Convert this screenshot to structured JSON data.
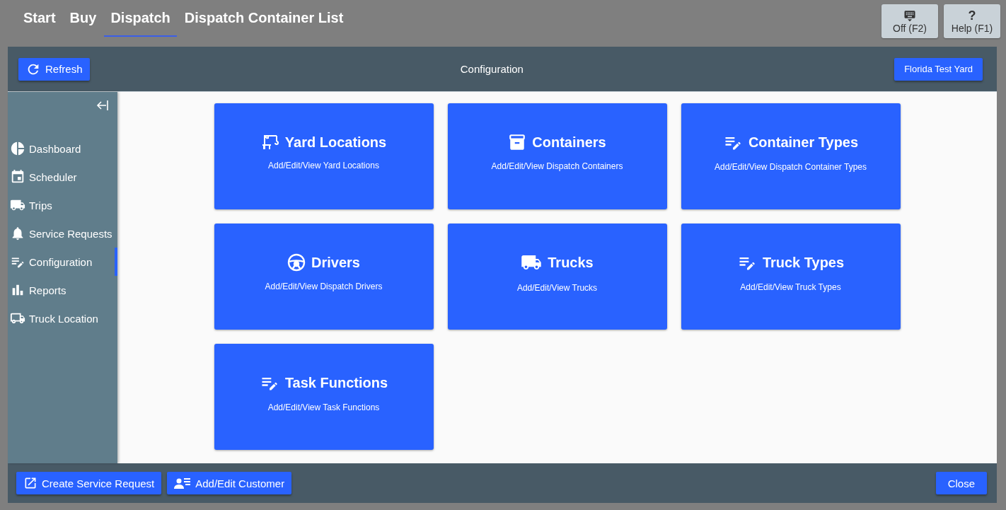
{
  "nav_tabs": [
    {
      "label": "Start",
      "selected": false
    },
    {
      "label": "Buy",
      "selected": false
    },
    {
      "label": "Dispatch",
      "selected": true
    },
    {
      "label": "Dispatch Container List",
      "selected": false
    }
  ],
  "top_buttons": [
    {
      "label": "Off (F2)"
    },
    {
      "label": "Help (F1)",
      "symbol": "?"
    }
  ],
  "header": {
    "refresh": "Refresh",
    "title": "Configuration",
    "yard": "Florida Test Yard"
  },
  "sidebar": {
    "items": [
      {
        "label": "Dashboard",
        "selected": false
      },
      {
        "label": "Scheduler",
        "selected": false
      },
      {
        "label": "Trips",
        "selected": false
      },
      {
        "label": "Service Requests",
        "selected": false
      },
      {
        "label": "Configuration",
        "selected": true
      },
      {
        "label": "Reports",
        "selected": false
      },
      {
        "label": "Truck Location",
        "selected": false
      }
    ]
  },
  "cards": [
    {
      "title": "Yard Locations",
      "subtitle": "Add/Edit/View Yard Locations"
    },
    {
      "title": "Containers",
      "subtitle": "Add/Edit/View Dispatch Containers"
    },
    {
      "title": "Container Types",
      "subtitle": "Add/Edit/View Dispatch Container Types"
    },
    {
      "title": "Drivers",
      "subtitle": "Add/Edit/View Dispatch Drivers"
    },
    {
      "title": "Trucks",
      "subtitle": "Add/Edit/View Trucks"
    },
    {
      "title": "Truck Types",
      "subtitle": "Add/Edit/View Truck Types"
    },
    {
      "title": "Task Functions",
      "subtitle": "Add/Edit/View Task Functions"
    }
  ],
  "footer": {
    "left_buttons": [
      "Create Service Request",
      "Add/Edit Customer"
    ],
    "close": "Close"
  }
}
